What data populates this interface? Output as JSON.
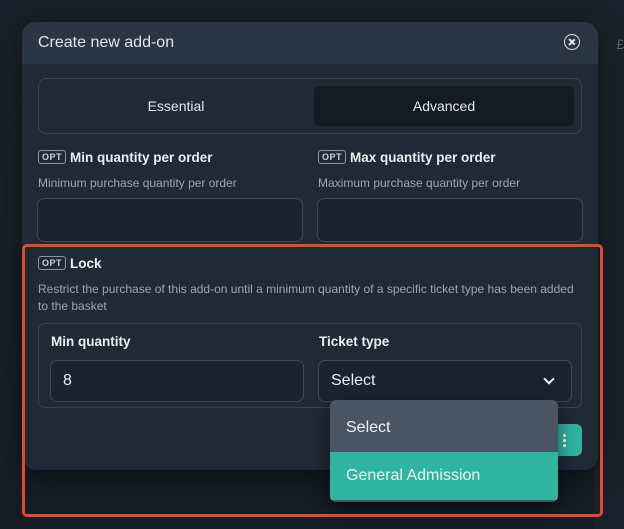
{
  "modal": {
    "title": "Create new add-on"
  },
  "tabs": [
    {
      "label": "Essential",
      "active": false
    },
    {
      "label": "Advanced",
      "active": true
    }
  ],
  "opt_badge": "OPT",
  "fields": {
    "min_qty_order": {
      "label": "Min quantity per order",
      "help": "Minimum purchase quantity per order",
      "value": ""
    },
    "max_qty_order": {
      "label": "Max quantity per order",
      "help": "Maximum purchase quantity per order",
      "value": ""
    }
  },
  "lock": {
    "label": "Lock",
    "help": "Restrict the purchase of this add-on until a minimum quantity of a specific ticket type has been added to the basket",
    "min_quantity": {
      "label": "Min quantity",
      "value": "8"
    },
    "ticket_type": {
      "label": "Ticket type",
      "selected": "Select",
      "options": [
        "Select",
        "General Admission"
      ],
      "highlighted_option": "General Admission"
    }
  },
  "background": {
    "edge_char": "£"
  },
  "colors": {
    "accent": "#2fb5a0",
    "highlight_frame": "#e3492a",
    "modal_bg": "#1f2a36",
    "header_bg": "#2a3643"
  },
  "icons": {
    "close": "close-circle-icon",
    "chevron": "chevron-down-icon",
    "submit": "more-vertical-icon"
  }
}
